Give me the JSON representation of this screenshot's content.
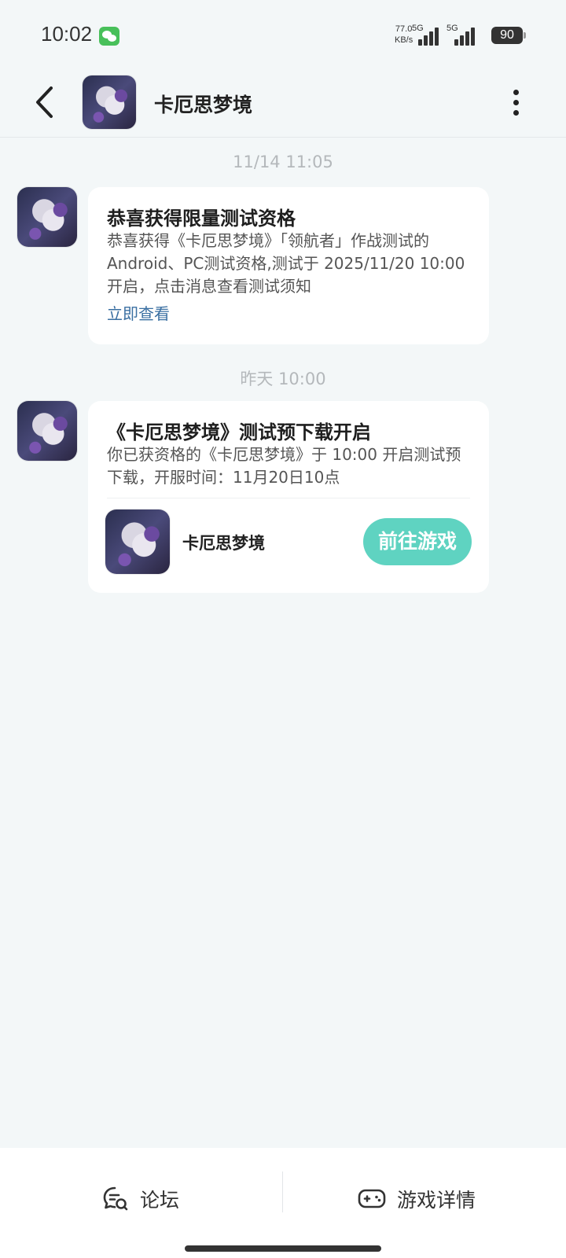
{
  "status_bar": {
    "time": "10:02",
    "net_speed_value": "77.0",
    "net_speed_unit": "KB/s",
    "sim1_label": "5G",
    "sim2_label": "5G",
    "battery": "90"
  },
  "header": {
    "title": "卡厄思梦境"
  },
  "messages": [
    {
      "timestamp": "11/14  11:05",
      "title": "恭喜获得限量测试资格",
      "body": "恭喜获得《卡厄思梦境》「领航者」作战测试的Android、PC测试资格,测试于 2025/11/20 10:00 开启，点击消息查看测试须知",
      "link": "立即查看"
    },
    {
      "timestamp": "昨天  10:00",
      "title": "《卡厄思梦境》测试预下载开启",
      "body": "你已获资格的《卡厄思梦境》于 10:00 开启测试预下载，开服时间：11月20日10点",
      "game_name": "卡厄思梦境",
      "button": "前往游戏"
    }
  ],
  "bottom_bar": {
    "forum": "论坛",
    "game_details": "游戏详情"
  },
  "colors": {
    "background": "#f3f7f8",
    "accent_button": "#5fd3c1",
    "link": "#3a6fa2"
  }
}
